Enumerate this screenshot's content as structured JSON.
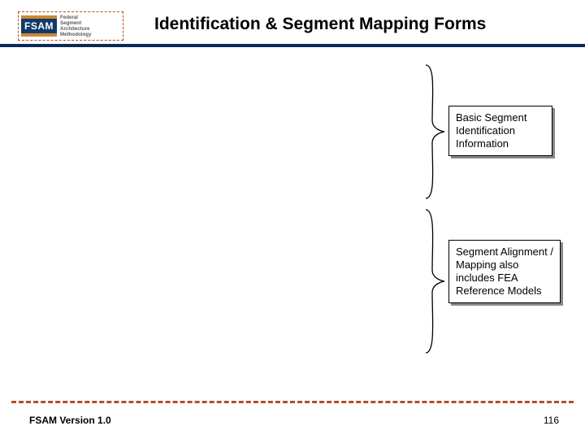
{
  "logo": {
    "mark": "FSAM",
    "lines": "Federal\nSegment\nArchitecture\nMethodology"
  },
  "title": "Identification & Segment Mapping Forms",
  "callouts": {
    "box1": "Basic Segment Identification Information",
    "box2": "Segment Alignment / Mapping also includes FEA Reference Models"
  },
  "footer": {
    "version": "FSAM Version 1.0",
    "page": "116"
  }
}
